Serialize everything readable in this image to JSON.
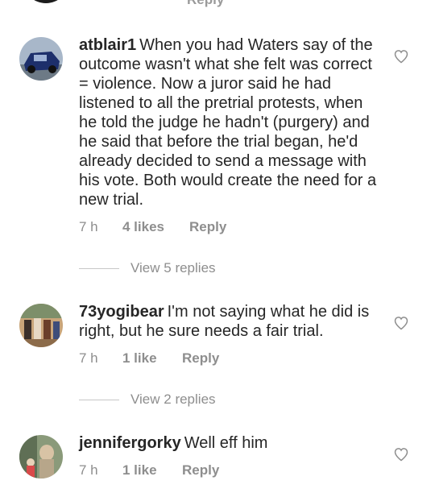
{
  "top": {
    "reply_label": "Reply"
  },
  "comments": [
    {
      "username": "atblair1",
      "text": "When you had Waters say of the outcome wasn't what she felt was correct = violence.  Now a juror said he had listened to all the pretrial protests, when he told the judge he hadn't (purgery)  and he said that before the trial began, he'd already decided to send a message with his vote.  Both would create the need for a new trial.",
      "time": "7 h",
      "likes": "4 likes",
      "reply_label": "Reply",
      "view_replies": "View 5 replies"
    },
    {
      "username": "73yogibear",
      "text": "I'm not saying what he did is right, but  he sure needs a fair trial.",
      "time": "7 h",
      "likes": "1 like",
      "reply_label": "Reply",
      "view_replies": "View 2 replies"
    },
    {
      "username": "jennifergorky",
      "text": "Well eff him",
      "time": "7 h",
      "likes": "1 like",
      "reply_label": "Reply"
    }
  ],
  "icons": {
    "like": "heart-outline-icon"
  },
  "colors": {
    "text": "#262626",
    "meta": "#8e8e8e",
    "divider": "#c7c7c7"
  }
}
